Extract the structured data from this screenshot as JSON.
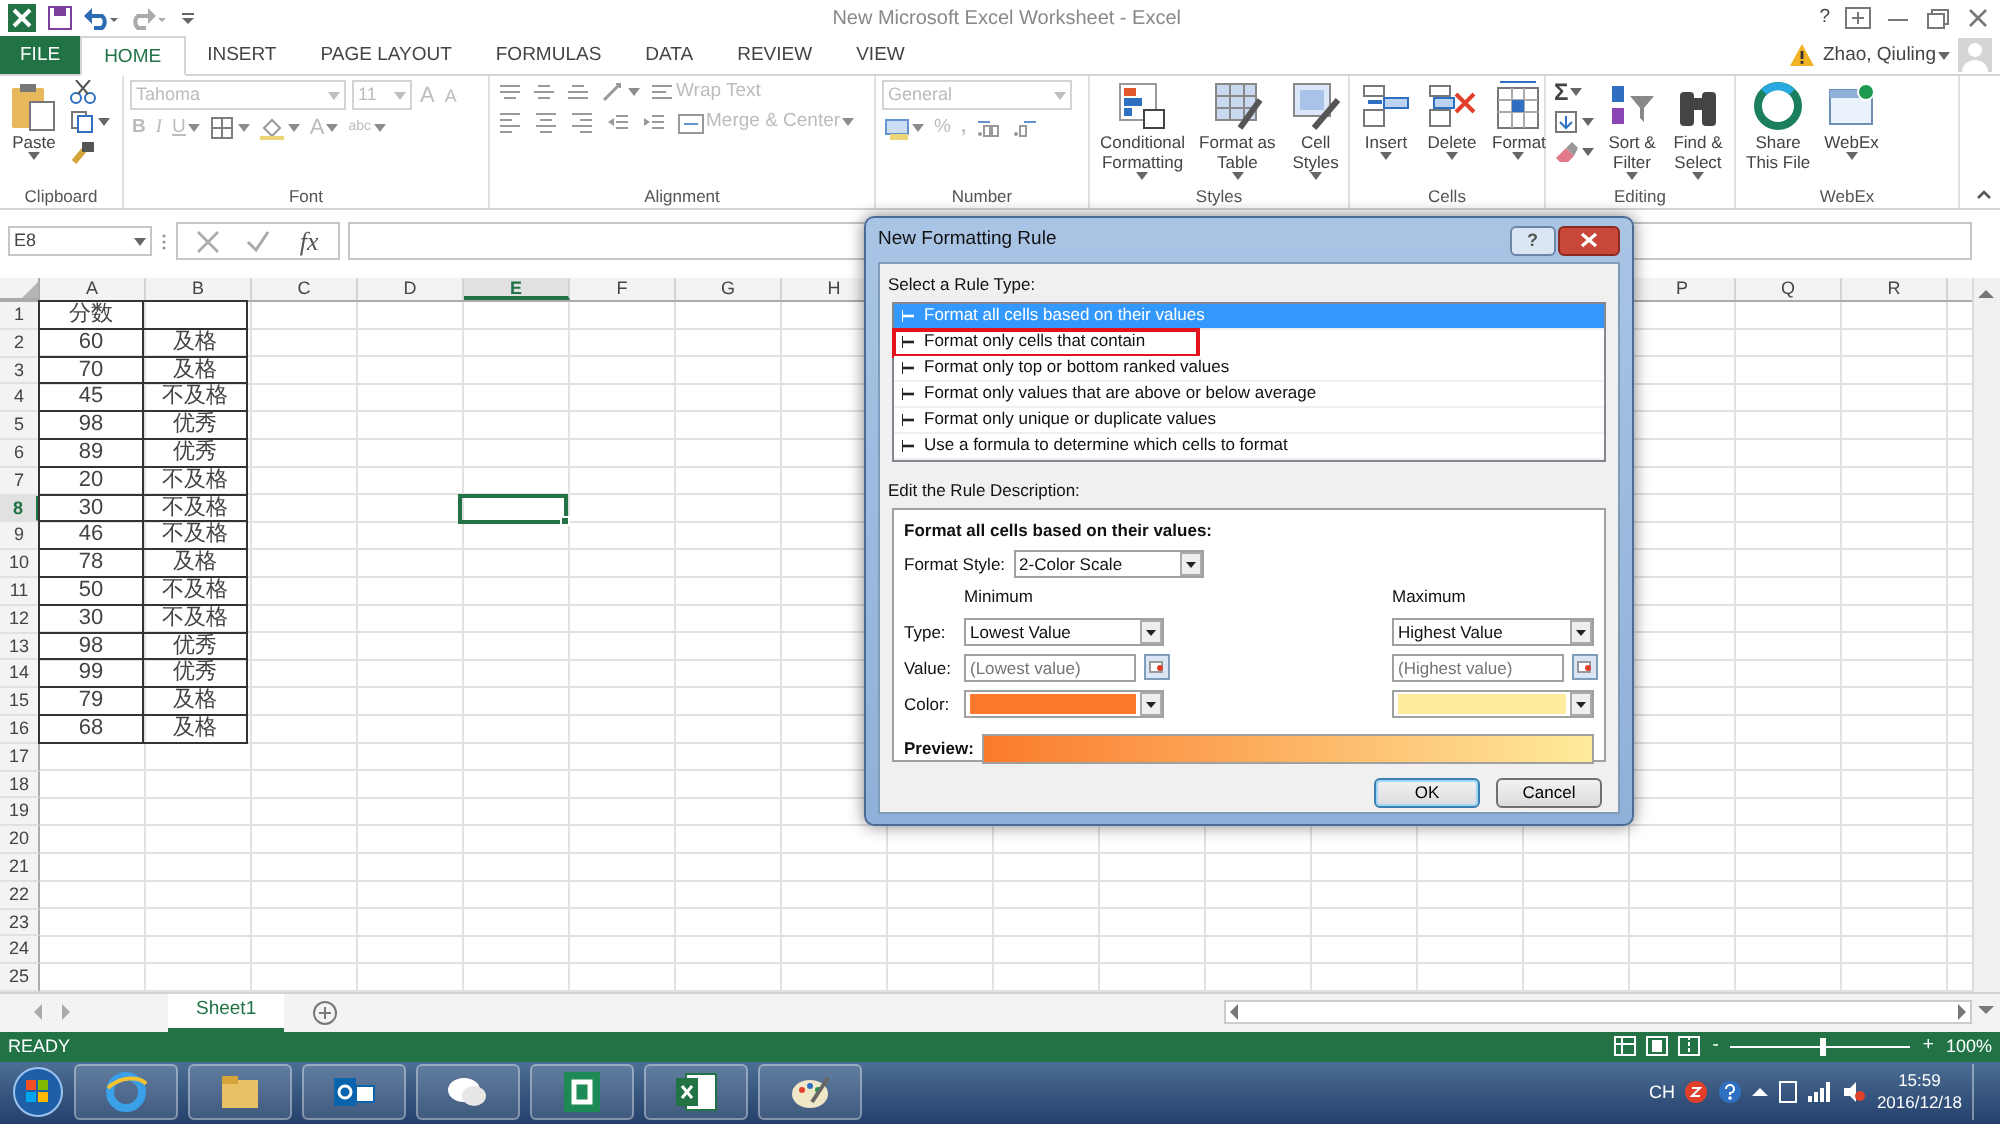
{
  "window": {
    "title": "New Microsoft Excel Worksheet - Excel",
    "help": "?"
  },
  "tabs": [
    {
      "label": "FILE",
      "kind": "file",
      "selected": false
    },
    {
      "label": "HOME",
      "kind": "tab",
      "selected": true
    },
    {
      "label": "INSERT",
      "kind": "tab",
      "selected": false
    },
    {
      "label": "PAGE LAYOUT",
      "kind": "tab",
      "selected": false
    },
    {
      "label": "FORMULAS",
      "kind": "tab",
      "selected": false
    },
    {
      "label": "DATA",
      "kind": "tab",
      "selected": false
    },
    {
      "label": "REVIEW",
      "kind": "tab",
      "selected": false
    },
    {
      "label": "VIEW",
      "kind": "tab",
      "selected": false
    }
  ],
  "user": {
    "name": "Zhao, Qiuling"
  },
  "ribbon": {
    "groups": [
      {
        "kind": "clipboard",
        "label": "Clipboard",
        "disabled": false,
        "paste": "Paste"
      },
      {
        "kind": "font",
        "label": "Font",
        "disabled": true,
        "font_name": "Tahoma",
        "font_size": "11",
        "grow_font": "A",
        "shrink_font": "A",
        "bold": "B",
        "italic": "I",
        "underline": "U",
        "font_color": "A",
        "phonetic": "abc"
      },
      {
        "kind": "alignment",
        "label": "Alignment",
        "disabled": true,
        "wrap_text": "Wrap Text",
        "merge": "Merge & Center"
      },
      {
        "kind": "number",
        "label": "Number",
        "disabled": true,
        "format": "General",
        "percent": "%",
        "comma": ","
      },
      {
        "kind": "large",
        "label": "Styles",
        "disabled": false,
        "buttons": [
          {
            "label": "Conditional\nFormatting",
            "dropdown": true
          },
          {
            "label": "Format as\nTable",
            "dropdown": true
          },
          {
            "label": "Cell\nStyles",
            "dropdown": true
          }
        ]
      },
      {
        "kind": "large",
        "label": "Cells",
        "disabled": false,
        "buttons": [
          {
            "label": "Insert",
            "dropdown": true
          },
          {
            "label": "Delete",
            "dropdown": true
          },
          {
            "label": "Format",
            "dropdown": true
          }
        ]
      },
      {
        "kind": "editing",
        "label": "Editing",
        "disabled": false,
        "autosum": "Σ",
        "buttons": [
          {
            "label": "Sort &\nFilter",
            "dropdown": true
          },
          {
            "label": "Find &\nSelect",
            "dropdown": true
          }
        ]
      },
      {
        "kind": "large",
        "label": "WebEx",
        "disabled": false,
        "buttons": [
          {
            "label": "Share\nThis File",
            "dropdown": false
          },
          {
            "label": "WebEx",
            "dropdown": true
          }
        ]
      }
    ]
  },
  "sheet": {
    "name_box": "E8",
    "function_label": "fx",
    "columns": [
      {
        "label": "A",
        "selected": false
      },
      {
        "label": "B",
        "selected": false
      },
      {
        "label": "C",
        "selected": false
      },
      {
        "label": "D",
        "selected": false
      },
      {
        "label": "E",
        "selected": true
      },
      {
        "label": "F",
        "selected": false
      },
      {
        "label": "G",
        "selected": false
      },
      {
        "label": "H",
        "selected": false
      },
      {
        "label": "P",
        "selected": false
      },
      {
        "label": "Q",
        "selected": false
      },
      {
        "label": "R",
        "selected": false
      }
    ],
    "rows": [
      {
        "number": "1",
        "selected": false,
        "a": "分数"
      },
      {
        "number": "2",
        "selected": false,
        "a": "60",
        "b": "及格"
      },
      {
        "number": "3",
        "selected": false,
        "a": "70",
        "b": "及格"
      },
      {
        "number": "4",
        "selected": false,
        "a": "45",
        "b": "不及格"
      },
      {
        "number": "5",
        "selected": false,
        "a": "98",
        "b": "优秀"
      },
      {
        "number": "6",
        "selected": false,
        "a": "89",
        "b": "优秀"
      },
      {
        "number": "7",
        "selected": false,
        "a": "20",
        "b": "不及格"
      },
      {
        "number": "8",
        "selected": true,
        "a": "30",
        "b": "不及格"
      },
      {
        "number": "9",
        "selected": false,
        "a": "46",
        "b": "不及格"
      },
      {
        "number": "10",
        "selected": false,
        "a": "78",
        "b": "及格"
      },
      {
        "number": "11",
        "selected": false,
        "a": "50",
        "b": "不及格"
      },
      {
        "number": "12",
        "selected": false,
        "a": "30",
        "b": "不及格"
      },
      {
        "number": "13",
        "selected": false,
        "a": "98",
        "b": "优秀"
      },
      {
        "number": "14",
        "selected": false,
        "a": "99",
        "b": "优秀"
      },
      {
        "number": "15",
        "selected": false,
        "a": "79",
        "b": "及格"
      },
      {
        "number": "16",
        "selected": false,
        "a": "68",
        "b": "及格"
      },
      {
        "number": "17",
        "selected": false
      },
      {
        "number": "18",
        "selected": false
      },
      {
        "number": "19",
        "selected": false
      },
      {
        "number": "20",
        "selected": false
      },
      {
        "number": "21",
        "selected": false
      },
      {
        "number": "22",
        "selected": false
      },
      {
        "number": "23",
        "selected": false
      },
      {
        "number": "24",
        "selected": false
      },
      {
        "number": "25",
        "selected": false
      }
    ]
  },
  "sheet_tabs": [
    {
      "label": "Sheet1",
      "selected": true
    }
  ],
  "status_bar": {
    "text": "READY",
    "zoom": {
      "minus": "-",
      "plus": "+",
      "label": "100%",
      "level": 0.5
    }
  },
  "dialog": {
    "title": "New Formatting Rule",
    "help": "?",
    "rule_type_label": "Select a Rule Type:",
    "rule_types": [
      {
        "label": "Format all cells based on their values",
        "selected": true,
        "highlighted": false
      },
      {
        "label": "Format only cells that contain",
        "selected": false,
        "highlighted": true
      },
      {
        "label": "Format only top or bottom ranked values",
        "selected": false,
        "highlighted": false
      },
      {
        "label": "Format only values that are above or below average",
        "selected": false,
        "highlighted": false
      },
      {
        "label": "Format only unique or duplicate values",
        "selected": false,
        "highlighted": false
      },
      {
        "label": "Use a formula to determine which cells to format",
        "selected": false,
        "highlighted": false
      }
    ],
    "description_label": "Edit the Rule Description:",
    "description_heading": "Format all cells based on their values:",
    "format_style_label": "Format Style:",
    "format_style": "2-Color Scale",
    "type_label": "Type:",
    "value_label": "Value:",
    "color_label": "Color:",
    "minimum": {
      "heading": "Minimum",
      "type": "Lowest Value",
      "value_placeholder": "(Lowest value)",
      "color": "#fb7a2b"
    },
    "maximum": {
      "heading": "Maximum",
      "type": "Highest Value",
      "value_placeholder": "(Highest value)",
      "color": "#ffeb9c"
    },
    "preview_label": "Preview:",
    "buttons": [
      {
        "label": "OK",
        "kind": "default"
      },
      {
        "label": "Cancel",
        "kind": "normal"
      }
    ]
  },
  "taskbar": {
    "language": "CH",
    "time": "15:59",
    "date": "2016/12/18"
  }
}
